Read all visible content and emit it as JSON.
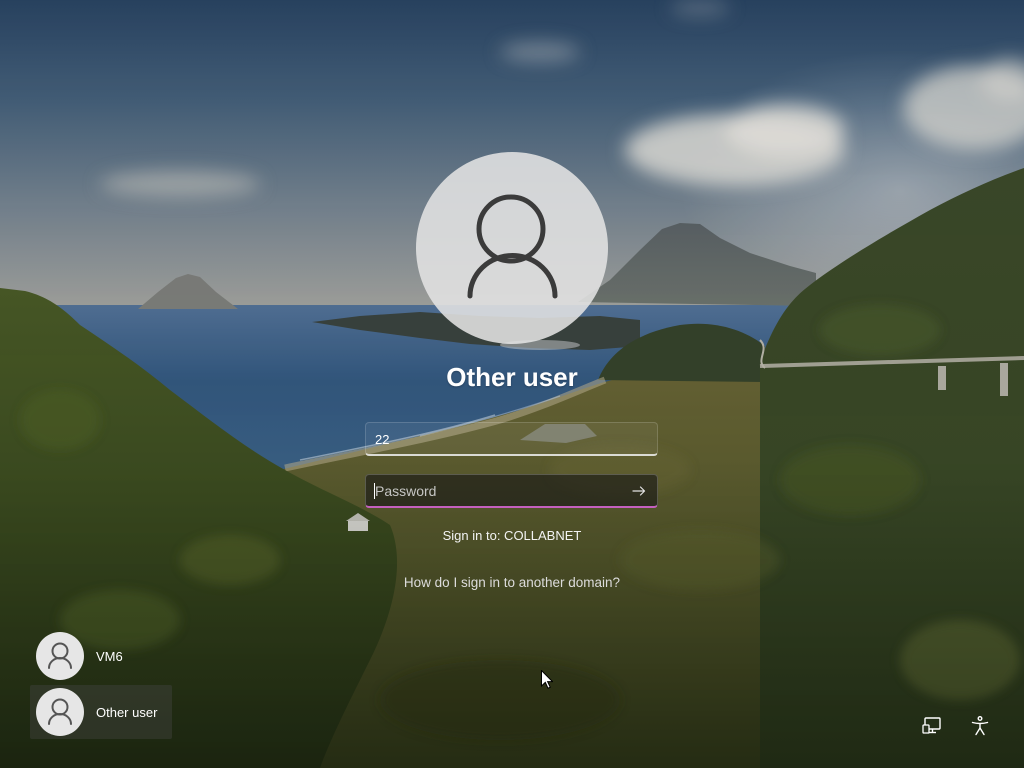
{
  "user": {
    "title": "Other user",
    "avatar_icon": "person-icon"
  },
  "form": {
    "username_value": "22",
    "password_placeholder": "Password",
    "submit_icon": "arrow-right-icon",
    "sign_in_to": "Sign in to: COLLABNET",
    "help_link": "How do I sign in to another domain?"
  },
  "users_list": [
    {
      "name": "VM6",
      "icon": "person-icon"
    },
    {
      "name": "Other user",
      "icon": "person-icon"
    }
  ],
  "system_icons": [
    {
      "icon": "network-icon"
    },
    {
      "icon": "accessibility-icon"
    }
  ],
  "colors": {
    "focus_accent": "#c460bf",
    "text": "#ffffff",
    "avatar_fill": "#e2e2e2",
    "avatar_glyph": "#3b3b3b"
  }
}
